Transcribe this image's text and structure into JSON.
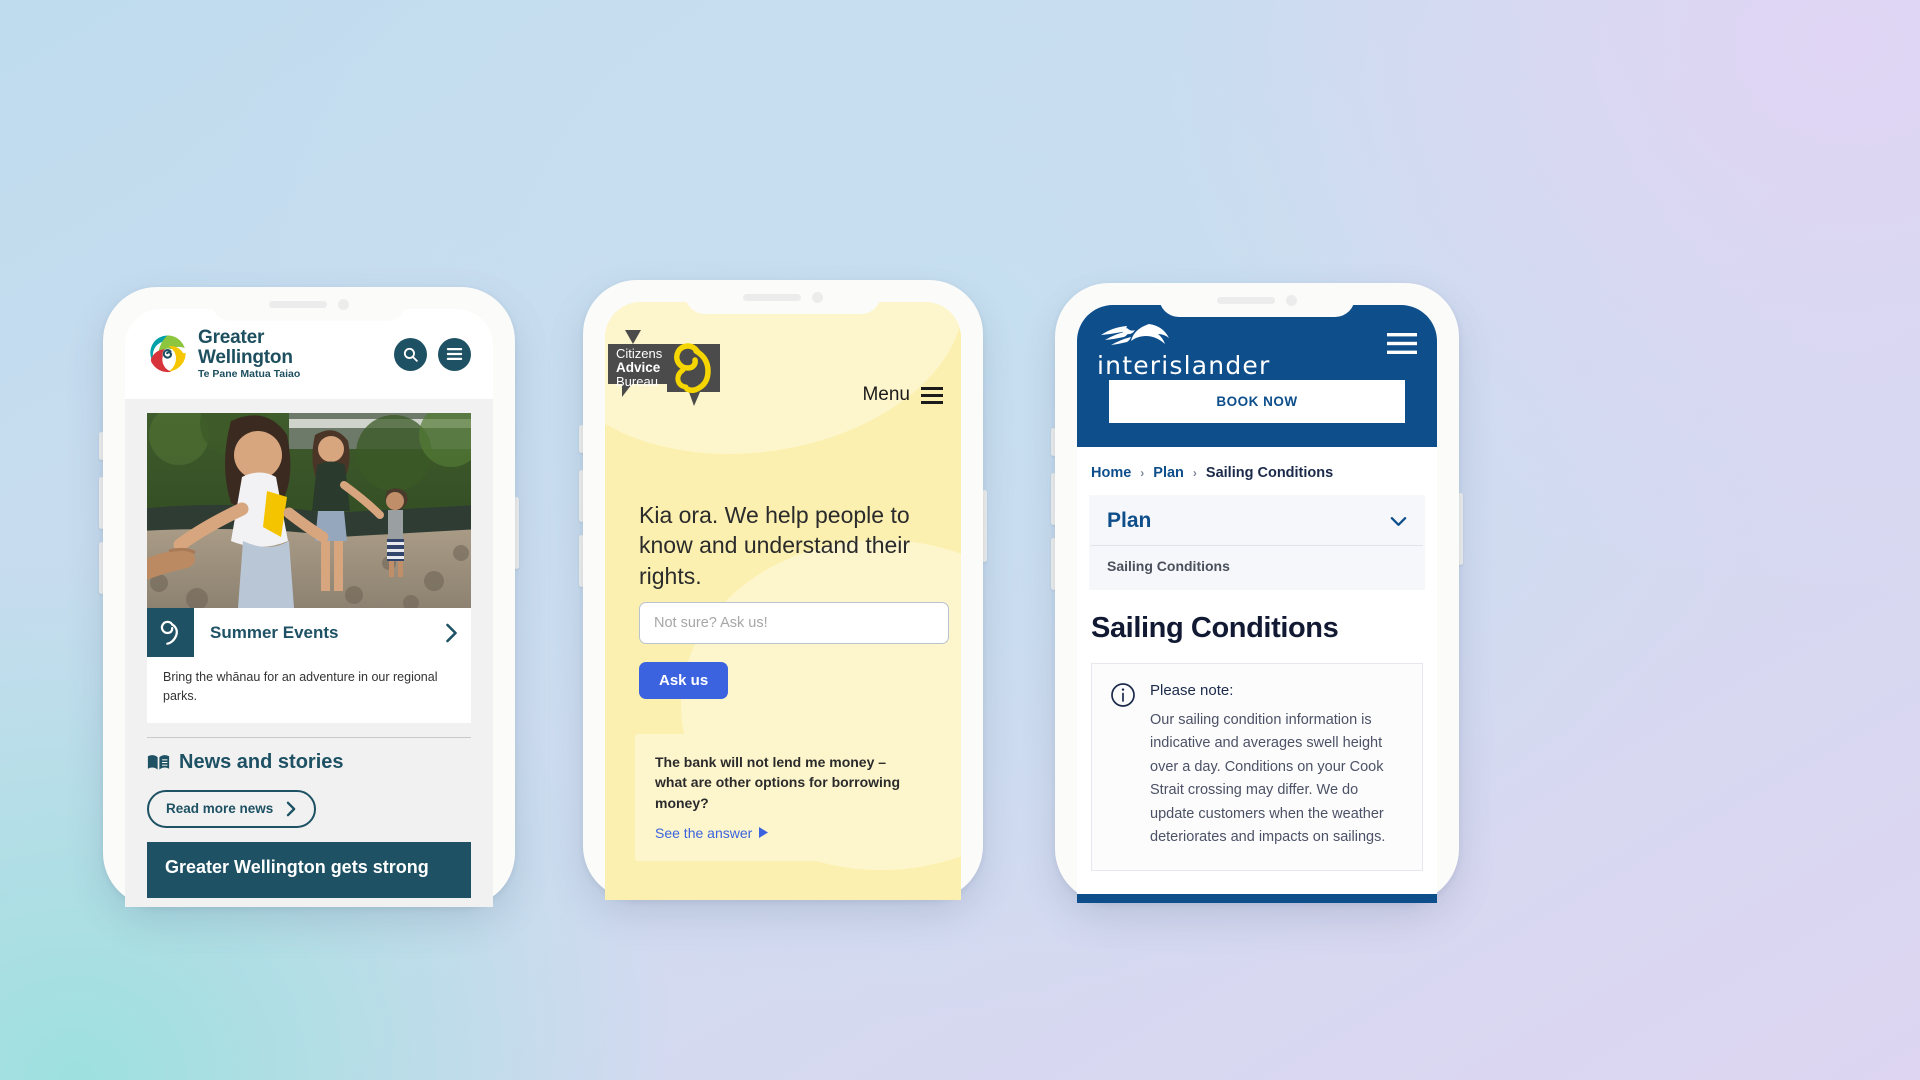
{
  "background": {
    "gradient_from": "#bedcee",
    "gradient_mid": "#cfdcf0",
    "gradient_to": "#ddd5f1",
    "accent_aqua": "#9de0df"
  },
  "phones": {
    "greater_wellington": {
      "brand": {
        "line1": "Greater",
        "line2": "Wellington",
        "tagline": "Te Pane Matua Taiao",
        "primary_color": "#1d5163"
      },
      "header_actions": [
        {
          "name": "search-button",
          "icon": "search-icon"
        },
        {
          "name": "menu-button",
          "icon": "hamburger-icon"
        }
      ],
      "hero": {
        "alt": "Family walking along a river in a regional park",
        "banner_title": "Summer Events",
        "banner_icon": "koru-icon",
        "chevron": "chevron-right-icon",
        "blurb": "Bring the whānau for an adventure in our regional parks."
      },
      "news": {
        "section_icon": "book-icon",
        "section_title": "News and stories",
        "read_more_label": "Read more news",
        "card_title": "Greater Wellington gets strong"
      }
    },
    "citizens_advice_bureau": {
      "logo": {
        "line1": "Citizens",
        "line2": "Advice",
        "line3": "Bureau",
        "bubble_color": "#4b4b4b",
        "koru_color": "#f5d600"
      },
      "menu_label": "Menu",
      "heading": "Kia ora. We help people to know and understand their rights.",
      "search_placeholder": "Not sure? Ask us!",
      "search_value": "",
      "ask_button_label": "Ask us",
      "ask_button_color": "#3b63df",
      "question_card": {
        "question": "The bank will not lend me money – what are other options for borrowing money?",
        "link_label": "See the answer",
        "link_icon": "triangle-right-icon"
      },
      "background_color": "#fbf0b0"
    },
    "interislander": {
      "brand": {
        "wordmark": "interislander",
        "mark": "dolphin-fern-icon",
        "primary_color": "#0d4e8b"
      },
      "book_now_label": "BOOK NOW",
      "menu_icon": "hamburger-icon",
      "breadcrumbs": [
        {
          "label": "Home",
          "current": false
        },
        {
          "label": "Plan",
          "current": false
        },
        {
          "label": "Sailing Conditions",
          "current": true
        }
      ],
      "breadcrumb_separator": "›",
      "accordion": {
        "title": "Plan",
        "chevron": "chevron-down-icon",
        "items": [
          "Sailing Conditions"
        ]
      },
      "page_title": "Sailing Conditions",
      "note": {
        "icon": "info-icon",
        "title": "Please note:",
        "text": "Our sailing condition information is indicative and averages swell height over a day. Conditions on your Cook Strait crossing may differ. We do update customers when the weather deteriorates and impacts on sailings."
      }
    }
  }
}
